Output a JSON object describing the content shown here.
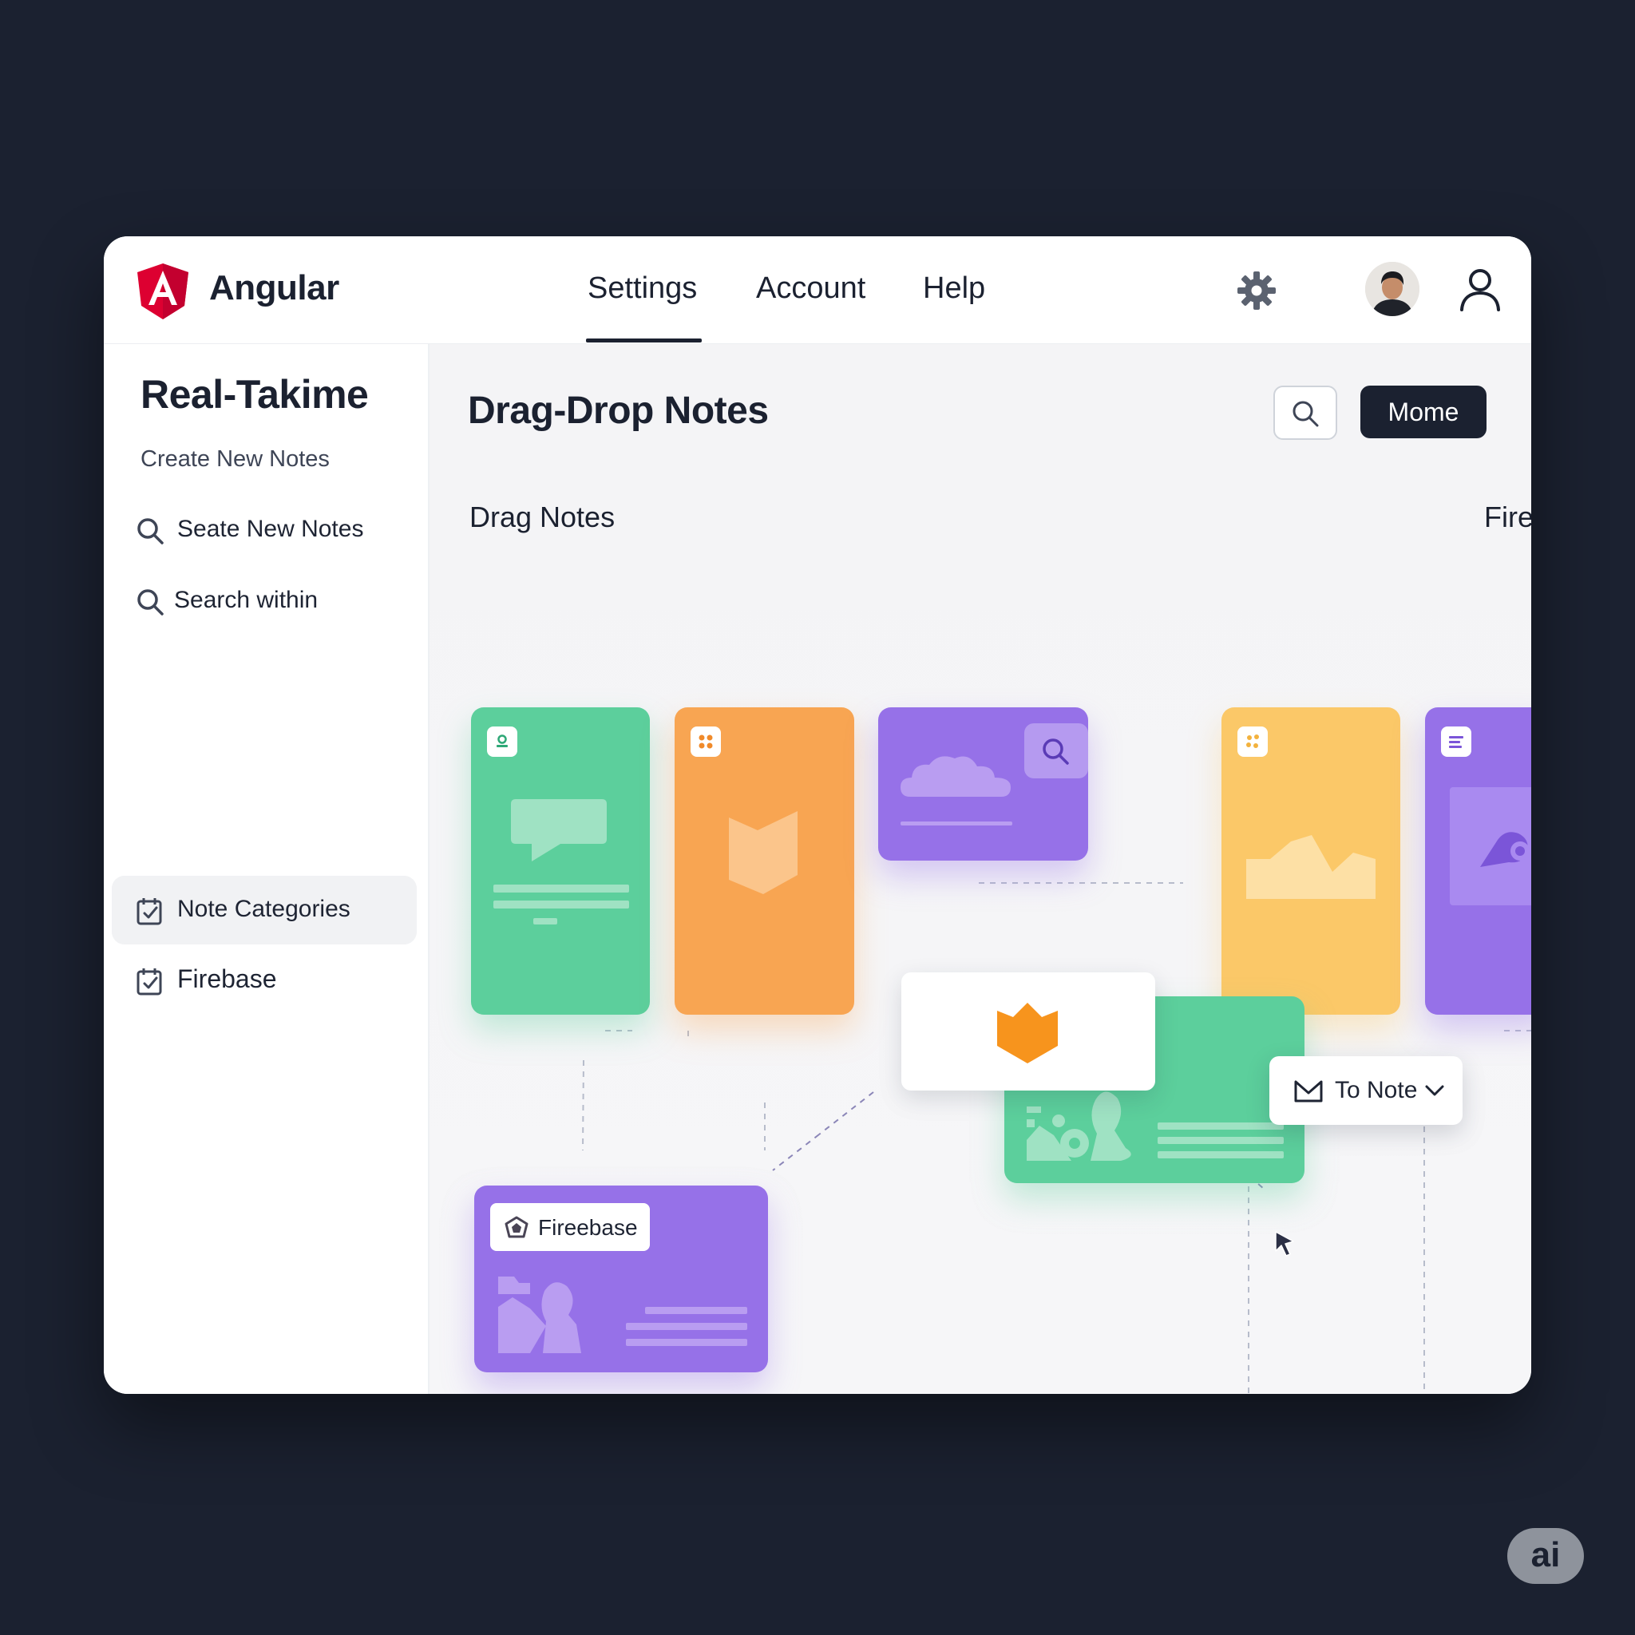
{
  "app": {
    "logo_text": "Angular",
    "accent": "#dd0031"
  },
  "nav": {
    "tabs": [
      {
        "label": "Settings",
        "active": true
      },
      {
        "label": "Account",
        "active": false
      },
      {
        "label": "Help",
        "active": false
      }
    ]
  },
  "header_icons": [
    "gear-icon",
    "avatar",
    "user-icon"
  ],
  "sidebar": {
    "title": "Real-Takime",
    "subtitle": "Create New Notes",
    "items": [
      {
        "label": "Seate New Notes",
        "icon": "search-icon",
        "active": false
      },
      {
        "label": "Search within",
        "icon": "search-icon",
        "active": false
      },
      {
        "label": "Note Categories",
        "icon": "calendar-check-icon",
        "active": true
      },
      {
        "label": "Firebase",
        "icon": "calendar-check-icon",
        "active": false
      }
    ]
  },
  "main": {
    "title": "Drag-Drop Notes",
    "primary_button": "Mome",
    "section_left": "Drag Notes",
    "section_right": "Firebase",
    "card_tag": "Fireebase",
    "dropdown_label": "To Note"
  },
  "colors": {
    "green": "#5ccf9c",
    "orange": "#f8a552",
    "purple": "#9671e8",
    "yellow": "#fbc868",
    "dark": "#1b2130"
  },
  "corner_badge": "ai"
}
